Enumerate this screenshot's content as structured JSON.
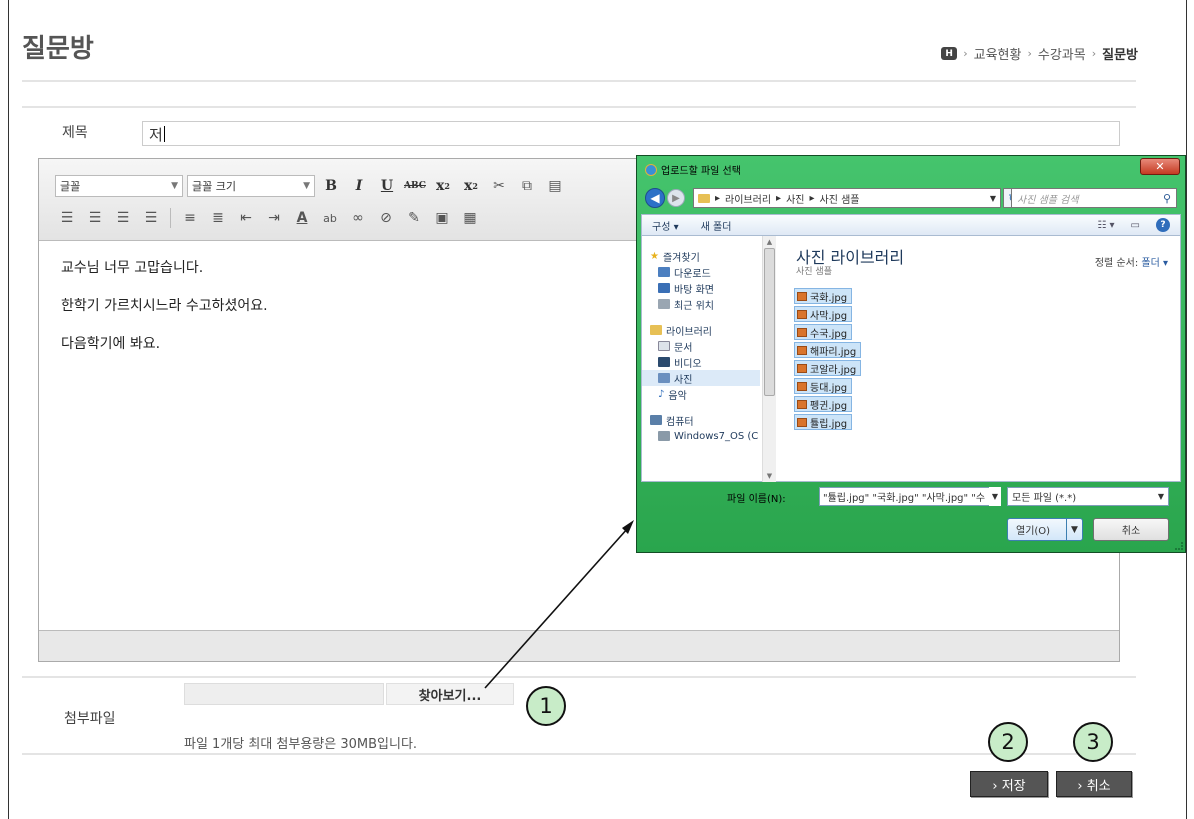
{
  "page": {
    "title": "질문방",
    "breadcrumb": {
      "home": "H",
      "items": [
        "교육현황",
        "수강과목",
        "질문방"
      ],
      "separator": "›"
    }
  },
  "subject": {
    "label": "제목",
    "value": "저"
  },
  "editor": {
    "font_family": "글꼴",
    "font_size": "글꼴 크기",
    "content": [
      "교수님 너무 고맙습니다.",
      "한학기 가르치시느라 수고하셨어요.",
      "다음학기에 봐요."
    ]
  },
  "attachment": {
    "label": "첨부파일",
    "browse": "찾아보기...",
    "note": "파일 1개당 최대 첨부용량은 30MB입니다."
  },
  "buttons": {
    "save": "› 저장",
    "cancel": "› 취소"
  },
  "callouts": [
    "1",
    "2",
    "3"
  ],
  "dialog": {
    "title": "업로드할 파일 선택",
    "path": [
      "라이브러리",
      "사진",
      "사진 샘플"
    ],
    "search_placeholder": "사진 샘플 검색",
    "commands": {
      "organize": "구성 ▾",
      "new_folder": "새 폴더"
    },
    "nav": {
      "favorites": "즐겨찾기",
      "favorites_items": [
        "다운로드",
        "바탕 화면",
        "최근 위치"
      ],
      "libraries": "라이브러리",
      "library_items": [
        "문서",
        "비디오",
        "사진",
        "음악"
      ],
      "computer": "컴퓨터",
      "computer_items": [
        "Windows7_OS (C"
      ]
    },
    "library_title": "사진 라이브러리",
    "library_sub": "사진 샘플",
    "sort_label": "정렬 순서:",
    "sort_value": "폴더 ▾",
    "files": [
      "국화.jpg",
      "사막.jpg",
      "수국.jpg",
      "해파리.jpg",
      "코알라.jpg",
      "등대.jpg",
      "펭귄.jpg",
      "튤립.jpg"
    ],
    "filename_label": "파일 이름(N):",
    "filename_value": "\"튤립.jpg\" \"국화.jpg\" \"사막.jpg\" \"수",
    "filter": "모든 파일 (*.*)",
    "open": "열기(O)",
    "cancel": "취소"
  }
}
